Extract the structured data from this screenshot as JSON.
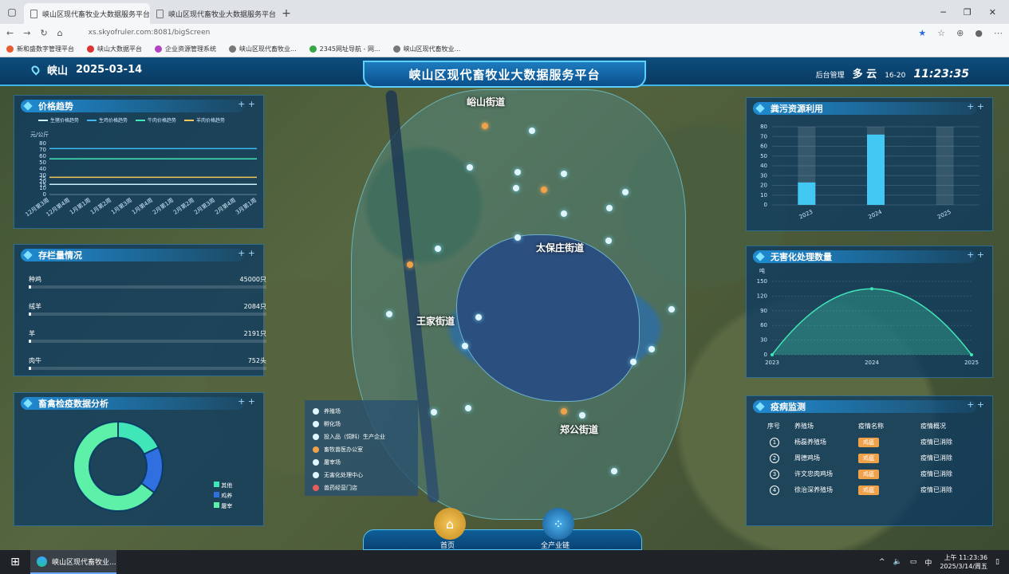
{
  "browser": {
    "tabs": [
      {
        "label": "峡山区现代畜牧业大数据服务平台"
      },
      {
        "label": "峡山区现代畜牧业大数据服务平台"
      }
    ],
    "url": "xs.skyofruler.com:8081/bigScreen",
    "bookmarks": [
      {
        "label": "新和盛数字管理平台",
        "color": "#e65c2f"
      },
      {
        "label": "峡山大数据平台",
        "color": "#d33"
      },
      {
        "label": "企业资源管理系统",
        "color": "#b044c2"
      },
      {
        "label": "峡山区现代畜牧业...",
        "color": "#777"
      },
      {
        "label": "2345网址导航 - 网...",
        "color": "#3aa64a"
      },
      {
        "label": "峡山区现代畜牧业...",
        "color": "#777"
      }
    ]
  },
  "header": {
    "location": "峡山",
    "date": "2025-03-14",
    "title": "峡山区现代畜牧业大数据服务平台",
    "admin": "后台管理",
    "weather": "多 云",
    "temp": "16-20",
    "time": "11:23:35"
  },
  "map": {
    "labels": [
      "峪山街道",
      "太保庄街道",
      "王家街道",
      "郑公街道"
    ],
    "legend": [
      "养殖场",
      "孵化场",
      "投入品（饲料）生产企业",
      "畜牧兽医办公室",
      "屠宰场",
      "无害化处理中心",
      "兽药经营门店"
    ]
  },
  "price_panel": {
    "title": "价格趋势",
    "legend": [
      "生猪价格趋势",
      "生鸡价格趋势",
      "牛肉价格趋势",
      "羊肉价格趋势"
    ],
    "unit": "元/公斤"
  },
  "stock_panel": {
    "title": "存栏量情况",
    "rows": [
      {
        "name": "种鸡",
        "value": "45000只",
        "fill": 0.01
      },
      {
        "name": "绒羊",
        "value": "2084只",
        "fill": 0.01
      },
      {
        "name": "羊",
        "value": "2191只",
        "fill": 0.01
      },
      {
        "name": "肉牛",
        "value": "752头",
        "fill": 0.01
      }
    ]
  },
  "quarantine_panel": {
    "title": "畜禽检疫数据分析",
    "legend": [
      "其他",
      "鸡养",
      "屠宰"
    ]
  },
  "manure_panel": {
    "title": "粪污资源利用"
  },
  "harmless_panel": {
    "title": "无害化处理数量",
    "unit": "吨"
  },
  "epidemic_panel": {
    "title": "疫病监测",
    "headers": [
      "序号",
      "养殖场",
      "疫情名称",
      "疫情概况"
    ],
    "rows": [
      {
        "no": "1",
        "farm": "杨磊养殖场",
        "disease": "鸡瘟",
        "status": "疫情已消除"
      },
      {
        "no": "2",
        "farm": "周德鸡场",
        "disease": "鸡瘟",
        "status": "疫情已消除"
      },
      {
        "no": "3",
        "farm": "许文忠肉鸡场",
        "disease": "鸡瘟",
        "status": "疫情已消除"
      },
      {
        "no": "4",
        "farm": "徐治深养殖场",
        "disease": "鸡瘟",
        "status": "疫情已消除"
      }
    ]
  },
  "nav": {
    "home": "首页",
    "chain": "全产业链"
  },
  "taskbar": {
    "app": "峡山区现代畜牧业...",
    "ime": "中",
    "time": "上午 11:23:36",
    "date": "2025/3/14/周五"
  },
  "chart_data": [
    {
      "type": "line",
      "title": "价格趋势",
      "ylabel": "元/公斤",
      "categories": [
        "12月第3周",
        "12月第4周",
        "1月第1周",
        "1月第2周",
        "1月第3周",
        "1月第4周",
        "2月第1周",
        "2月第2周",
        "2月第3周",
        "2月第4周",
        "3月第1周"
      ],
      "ylim": [
        0,
        80
      ],
      "yticks": [
        0,
        10,
        15,
        20,
        25,
        30,
        40,
        50,
        60,
        70,
        80
      ],
      "series": [
        {
          "name": "生猪价格趋势",
          "values": [
            16,
            16,
            16,
            16,
            16,
            16,
            16,
            16,
            16,
            16,
            16
          ],
          "color": "#c9f1ff"
        },
        {
          "name": "生鸡价格趋势",
          "values": [
            27,
            27,
            27,
            27,
            27,
            27,
            27,
            27,
            27,
            27,
            27
          ],
          "color": "#f5c65a"
        },
        {
          "name": "牛肉价格趋势",
          "values": [
            56,
            56,
            56,
            56,
            56,
            56,
            56,
            56,
            56,
            56,
            56
          ],
          "color": "#41e6b8"
        },
        {
          "name": "羊肉价格趋势",
          "values": [
            72,
            72,
            72,
            72,
            72,
            72,
            72,
            72,
            72,
            72,
            72
          ],
          "color": "#3fb9f0"
        }
      ]
    },
    {
      "type": "bar",
      "title": "粪污资源利用",
      "categories": [
        "2023",
        "2024",
        "2025"
      ],
      "values": [
        23,
        72,
        0
      ],
      "ylim": [
        0,
        80
      ],
      "yticks": [
        0,
        10,
        20,
        30,
        40,
        50,
        60,
        70,
        80
      ]
    },
    {
      "type": "area",
      "title": "无害化处理数量",
      "ylabel": "吨",
      "categories": [
        "2023",
        "2024",
        "2025"
      ],
      "values": [
        0,
        135,
        0
      ],
      "ylim": [
        0,
        150
      ],
      "yticks": [
        0,
        30,
        60,
        90,
        120,
        150
      ]
    },
    {
      "type": "pie",
      "title": "畜禽检疫数据分析",
      "labels": [
        "其他",
        "鸡养",
        "屠宰"
      ],
      "values": [
        18,
        17,
        65
      ],
      "colors": [
        "#41e6b8",
        "#2f6fe0",
        "#5cf0a8"
      ]
    }
  ]
}
